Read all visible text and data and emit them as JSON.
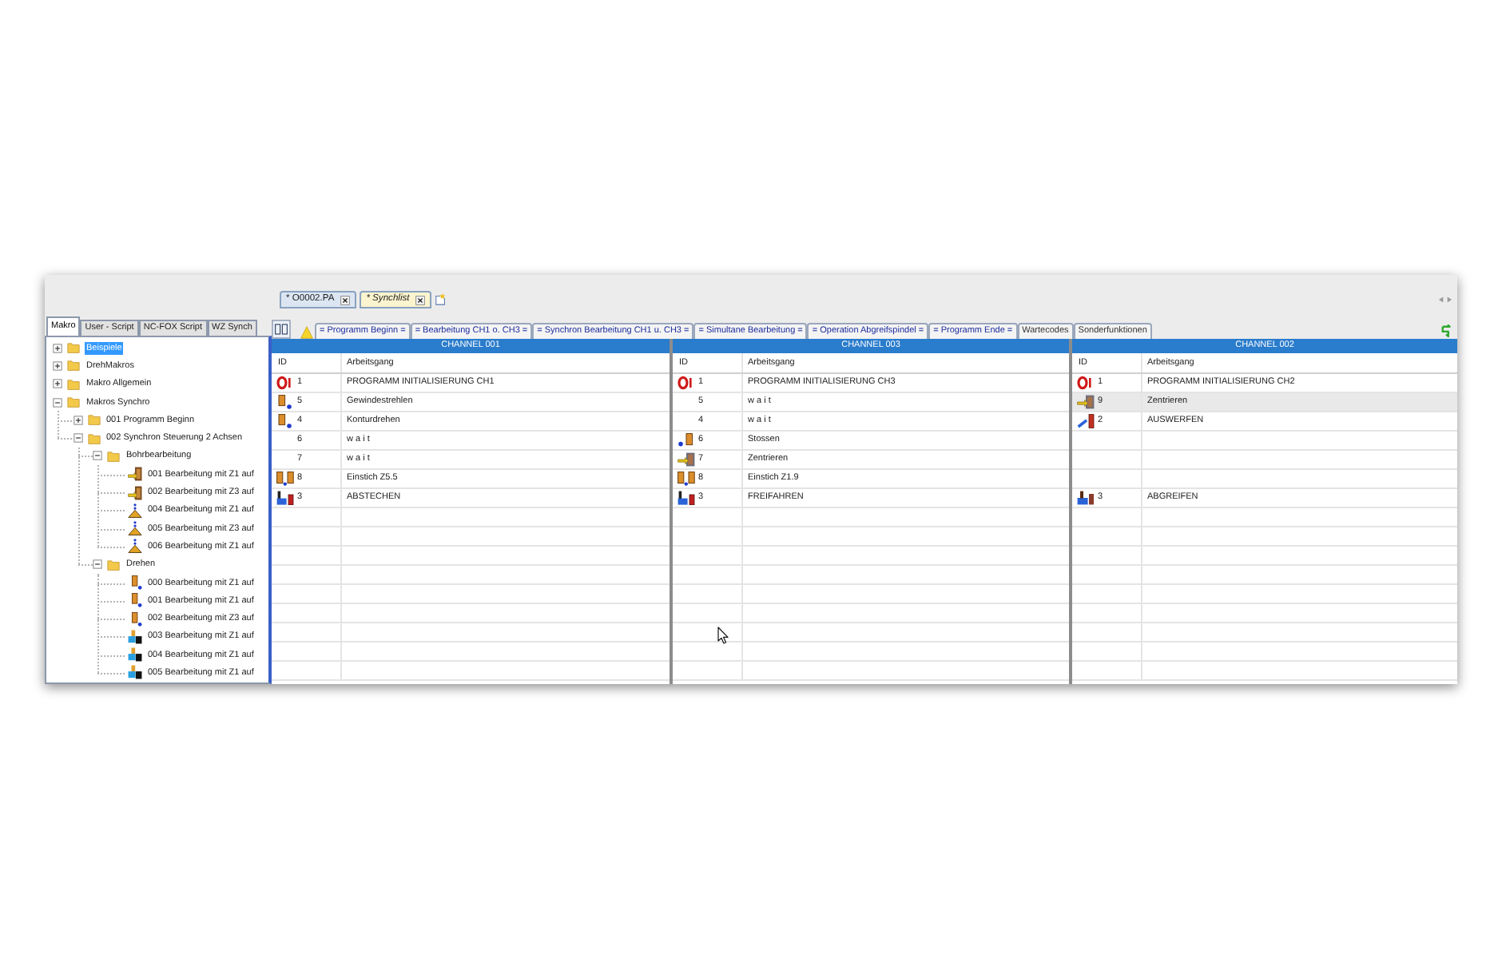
{
  "left_panel": {
    "tabs": [
      {
        "label": "Makro",
        "selected": true
      },
      {
        "label": "User - Script",
        "selected": false
      },
      {
        "label": "NC-FOX Script",
        "selected": false
      },
      {
        "label": "WZ Synch",
        "selected": false
      }
    ],
    "tree": [
      {
        "label": "Beispiele",
        "kind": "folder",
        "expanded": false,
        "selected": true
      },
      {
        "label": "DrehMakros",
        "kind": "folder",
        "expanded": false,
        "selected": false
      },
      {
        "label": "Makro Allgemein",
        "kind": "folder",
        "expanded": false,
        "selected": false
      },
      {
        "label": "Makros Synchro",
        "kind": "folder",
        "expanded": true,
        "selected": false,
        "children": [
          {
            "label": "001 Programm Beginn",
            "kind": "folder",
            "expanded": false,
            "selected": false
          },
          {
            "label": "002 Synchron Steuerung 2 Achsen",
            "kind": "folder",
            "expanded": true,
            "selected": false,
            "children": [
              {
                "label": "Bohrbearbeitung",
                "kind": "folder",
                "expanded": true,
                "selected": false,
                "children": [
                  {
                    "label": "001 Bearbeitung mit Z1 auf",
                    "kind": "mill",
                    "selected": false
                  },
                  {
                    "label": "002 Bearbeitung mit Z3 auf",
                    "kind": "mill",
                    "selected": false
                  },
                  {
                    "label": "004 Bearbeitung mit Z1 auf",
                    "kind": "drill",
                    "selected": false
                  },
                  {
                    "label": "005 Bearbeitung mit Z3 auf",
                    "kind": "drill",
                    "selected": false
                  },
                  {
                    "label": "006 Bearbeitung mit Z1 auf",
                    "kind": "drill",
                    "selected": false
                  }
                ]
              },
              {
                "label": "Drehen",
                "kind": "folder",
                "expanded": true,
                "selected": false,
                "children": [
                  {
                    "label": "000 Bearbeitung mit Z1 auf",
                    "kind": "turn",
                    "selected": false
                  },
                  {
                    "label": "001 Bearbeitung mit Z1 auf",
                    "kind": "turn",
                    "selected": false
                  },
                  {
                    "label": "002 Bearbeitung mit Z3 auf",
                    "kind": "turn",
                    "selected": false
                  },
                  {
                    "label": "003 Bearbeitung mit Z1 auf",
                    "kind": "part-off",
                    "selected": false
                  },
                  {
                    "label": "004 Bearbeitung mit Z1 auf",
                    "kind": "part-off",
                    "selected": false
                  },
                  {
                    "label": "005 Bearbeitung mit Z1 auf",
                    "kind": "part-off",
                    "selected": false
                  }
                ]
              }
            ]
          }
        ]
      }
    ]
  },
  "doc_tabs": [
    {
      "label": "* O0002.PA",
      "selected": false
    },
    {
      "label": "* Synchlist",
      "selected": true
    }
  ],
  "section_tabs": [
    {
      "label": "= Programm Beginn =",
      "kind": "section"
    },
    {
      "label": "= Bearbeitung CH1 o. CH3 =",
      "kind": "section"
    },
    {
      "label": "= Synchron Bearbeitung CH1 u. CH3 =",
      "kind": "section"
    },
    {
      "label": "= Simultane Bearbeitung =",
      "kind": "section"
    },
    {
      "label": "= Operation Abgreifspindel =",
      "kind": "section"
    },
    {
      "label": "= Programm Ende =",
      "kind": "section"
    },
    {
      "label": "Wartecodes",
      "kind": "plain"
    },
    {
      "label": "Sonderfunktionen",
      "kind": "plain"
    }
  ],
  "channels": [
    {
      "title": "CHANNEL 001",
      "columns": [
        "ID",
        "Arbeitsgang"
      ],
      "rows": [
        {
          "kind": "init",
          "id": "1",
          "name": "PROGRAMM INITIALISIERUNG CH1",
          "selected": false
        },
        {
          "kind": "tool",
          "id": "5",
          "name": "Gewindestrehlen",
          "selected": false
        },
        {
          "kind": "tool",
          "id": "4",
          "name": "Konturdrehen",
          "selected": false
        },
        {
          "kind": "wait",
          "id": "6",
          "name": "w a i t",
          "selected": false
        },
        {
          "kind": "wait",
          "id": "7",
          "name": "w a i t",
          "selected": false
        },
        {
          "kind": "tool-pair",
          "id": "8",
          "name": "Einstich Z5.5",
          "selected": false
        },
        {
          "kind": "part-off",
          "id": "3",
          "name": "ABSTECHEN",
          "selected": false
        }
      ]
    },
    {
      "title": "CHANNEL 003",
      "columns": [
        "ID",
        "Arbeitsgang"
      ],
      "rows": [
        {
          "kind": "init",
          "id": "1",
          "name": "PROGRAMM INITIALISIERUNG CH3",
          "selected": false
        },
        {
          "kind": "wait",
          "id": "5",
          "name": "w a i t",
          "selected": false
        },
        {
          "kind": "wait",
          "id": "4",
          "name": "w a i t",
          "selected": false
        },
        {
          "kind": "boring",
          "id": "6",
          "name": "Stossen",
          "selected": false
        },
        {
          "kind": "center",
          "id": "7",
          "name": "Zentrieren",
          "selected": false
        },
        {
          "kind": "tool-pair",
          "id": "8",
          "name": "Einstich Z1.9",
          "selected": false
        },
        {
          "kind": "part-off",
          "id": "3",
          "name": "FREIFAHREN",
          "selected": false
        }
      ]
    },
    {
      "title": "CHANNEL 002",
      "columns": [
        "ID",
        "Arbeitsgang"
      ],
      "rows": [
        {
          "kind": "init",
          "id": "1",
          "name": "PROGRAMM INITIALISIERUNG CH2",
          "selected": false
        },
        {
          "kind": "center",
          "id": "9",
          "name": "Zentrieren",
          "selected": true
        },
        {
          "kind": "eject",
          "id": "2",
          "name": "AUSWERFEN",
          "selected": false
        },
        {
          "kind": "blank",
          "selected": false
        },
        {
          "kind": "blank",
          "selected": false
        },
        {
          "kind": "blank",
          "selected": false
        },
        {
          "kind": "grip",
          "id": "3",
          "name": "ABGREIFEN",
          "selected": false
        }
      ]
    }
  ]
}
